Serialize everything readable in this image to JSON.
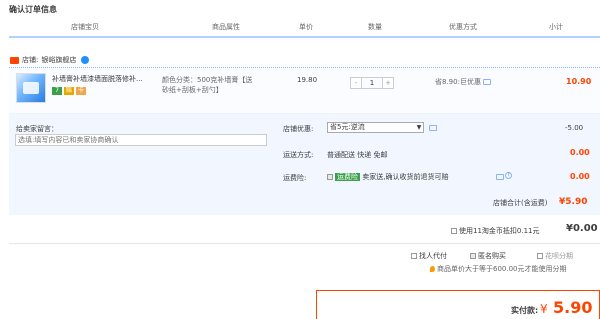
{
  "section_title": "确认订单信息",
  "columns": [
    "店铺宝贝",
    "商品属性",
    "单价",
    "数量",
    "优惠方式",
    "小计"
  ],
  "shop": {
    "label": "店铺:",
    "name": "银峪旗舰店"
  },
  "item": {
    "title": "补墙膏补墙漆墙面脱落修补...",
    "badges": [
      "7",
      "赔",
      "卡"
    ],
    "attributes": [
      "颜色分类：500克补墙膏【送",
      "砂纸+刮板+刮勺】"
    ],
    "price": "19.80",
    "quantity": "1",
    "qty_minus": "-",
    "qty_plus": "+",
    "discount": "省8.90:巨优惠",
    "subtotal": "10.90"
  },
  "remark": {
    "label": "给卖家留言：",
    "placeholder": "选填:填写内容已和卖家协商确认"
  },
  "shop_discount": {
    "label": "店铺优惠:",
    "selected": "省5元:逆流",
    "amount": "-5.00"
  },
  "shipping": {
    "label": "运送方式:",
    "value": "普通配送 快递 免邮",
    "amount": "0.00"
  },
  "insurance": {
    "label": "运费险:",
    "tag": "运费险",
    "text": "卖家送,确认收货前退货可赔",
    "amount": "0.00"
  },
  "shop_total": {
    "label": "店铺合计(含运费)",
    "value": "¥5.90"
  },
  "coins": {
    "label": "使用11淘金币抵扣0.11元",
    "value": "¥0.00"
  },
  "pay_options": {
    "proxy": "找人代付",
    "anonymous": "匿名购买",
    "installment": "花呗分期"
  },
  "installment_note": "商品单价大于等于600.00元才能使用分期",
  "final": {
    "label": "实付款:",
    "currency": "¥",
    "value": "5.90"
  },
  "colors": {
    "accent": "#ff4400",
    "header_line": "#b2d1ff",
    "option_bg": "#f2f7ff"
  }
}
